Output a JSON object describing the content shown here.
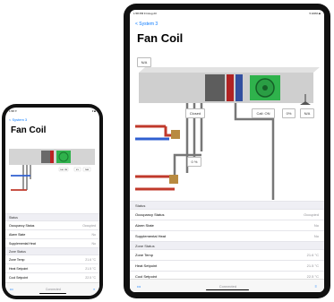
{
  "phone": {
    "time": "1:58 ✈",
    "right_status": "▾ ■",
    "back": "< System 3",
    "title": "Fan Coil",
    "tabbar": {
      "left": "•••",
      "center": "Connected",
      "right": "≡"
    }
  },
  "tablet": {
    "time": "1:58 PM  Fri Aug 23",
    "right_status": "▾ 100% ■",
    "back": "< System 3",
    "title": "Fan Coil",
    "tabbar": {
      "left": "•••",
      "center": "Connected",
      "right": "≡"
    }
  },
  "diagram": {
    "top_left": "N/A",
    "valve_top": "Closed",
    "call": "Call: ON",
    "pct": "0%",
    "na2": "N/A",
    "valve_bottom": "0 %"
  },
  "phone_diagram": {
    "a": "Call: ON",
    "b": "0%",
    "c": "N/A"
  },
  "sections": {
    "status_header": "Status",
    "zone_header": "Zone Status"
  },
  "status_rows": [
    {
      "label": "Occupancy Status",
      "value": "Occupied"
    },
    {
      "label": "Alarm State",
      "value": "No"
    },
    {
      "label": "Supplemental Heat",
      "value": "No"
    }
  ],
  "zone_rows": [
    {
      "label": "Zone Temp",
      "value": "21.6 °C"
    },
    {
      "label": "Heat Setpoint",
      "value": "21.5 °C"
    },
    {
      "label": "Cool Setpoint",
      "value": "22.5 °C"
    }
  ],
  "colors": {
    "accent": "#0a7aff",
    "fan": "#2fb24c",
    "pipe_hot": "#c0392b",
    "pipe_cold": "#2f5fd0",
    "pipe_gray": "#777777",
    "duct": "#cfcfcf"
  }
}
